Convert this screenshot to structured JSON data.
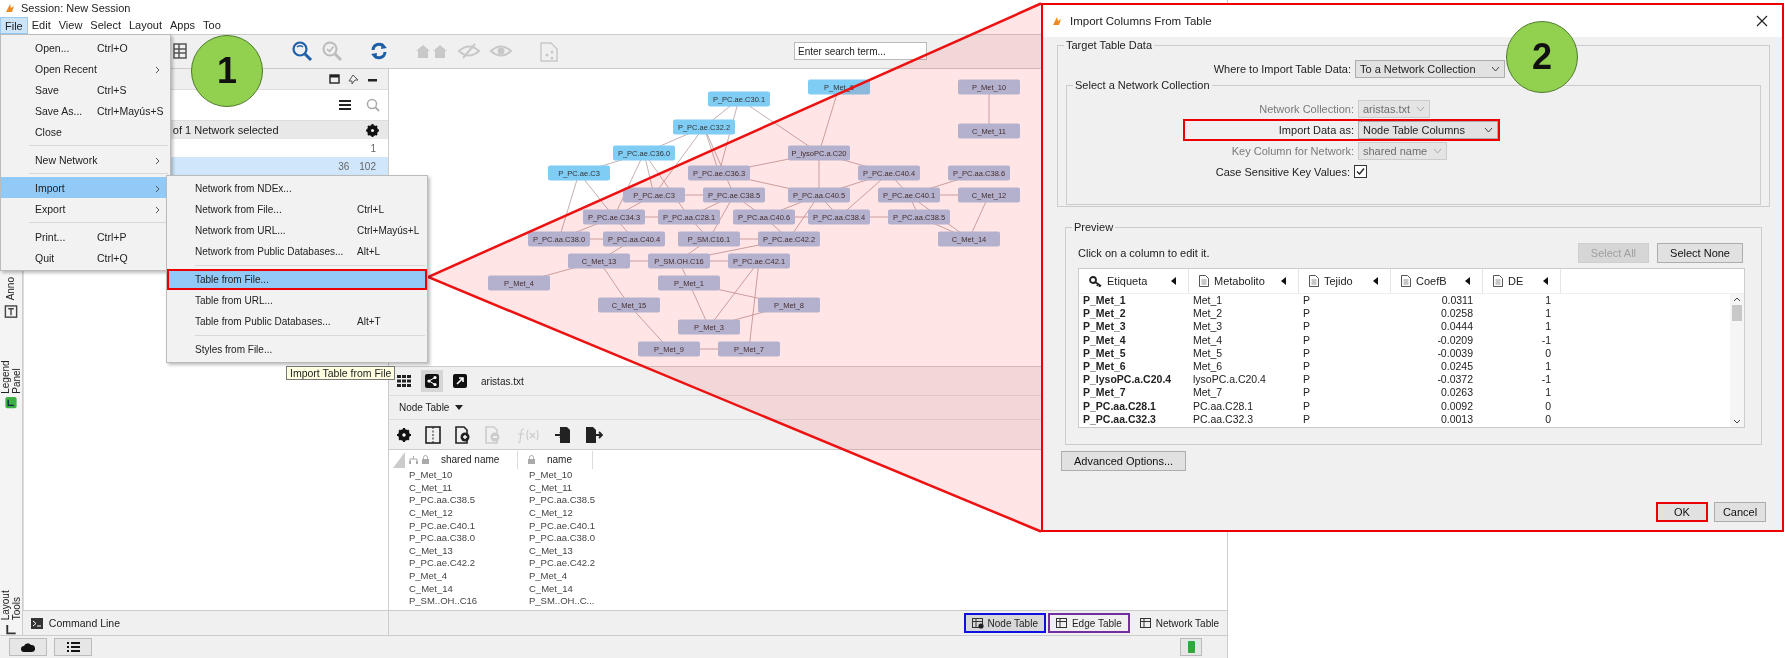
{
  "window": {
    "title": "Session: New Session"
  },
  "menubar": [
    {
      "label": "File",
      "selected": true
    },
    {
      "label": "Edit",
      "selected": false
    },
    {
      "label": "View",
      "selected": false
    },
    {
      "label": "Select",
      "selected": false
    },
    {
      "label": "Layout",
      "selected": false
    },
    {
      "label": "Apps",
      "selected": false
    },
    {
      "label": "Too",
      "selected": false
    }
  ],
  "file_menu": [
    {
      "kind": "item",
      "label": "Open...",
      "shortcut": "Ctrl+O",
      "has_submenu": false,
      "selected": false
    },
    {
      "kind": "item",
      "label": "Open Recent",
      "has_submenu": true,
      "selected": false
    },
    {
      "kind": "item",
      "label": "Save",
      "shortcut": "Ctrl+S",
      "has_submenu": false,
      "selected": false
    },
    {
      "kind": "item",
      "label": "Save As...",
      "shortcut": "Ctrl+Mayús+S",
      "has_submenu": false,
      "selected": false
    },
    {
      "kind": "item",
      "label": "Close",
      "has_submenu": false,
      "selected": false
    },
    {
      "kind": "separator"
    },
    {
      "kind": "item",
      "label": "New Network",
      "has_submenu": true,
      "selected": false
    },
    {
      "kind": "separator"
    },
    {
      "kind": "item",
      "label": "Import",
      "has_submenu": true,
      "selected": true
    },
    {
      "kind": "item",
      "label": "Export",
      "has_submenu": true,
      "selected": false
    },
    {
      "kind": "separator"
    },
    {
      "kind": "item",
      "label": "Print...",
      "shortcut": "Ctrl+P",
      "has_submenu": false,
      "selected": false
    },
    {
      "kind": "item",
      "label": "Quit",
      "shortcut": "Ctrl+Q",
      "has_submenu": false,
      "selected": false
    }
  ],
  "import_submenu": [
    {
      "kind": "item",
      "label": "Network from NDEx...",
      "selected": false,
      "highlighted": false
    },
    {
      "kind": "item",
      "label": "Network from File...",
      "shortcut": "Ctrl+L",
      "selected": false,
      "highlighted": false
    },
    {
      "kind": "item",
      "label": "Network from URL...",
      "shortcut": "Ctrl+Mayús+L",
      "selected": false,
      "highlighted": false
    },
    {
      "kind": "item",
      "label": "Network from Public Databases...",
      "shortcut": "Alt+L",
      "selected": false,
      "highlighted": false
    },
    {
      "kind": "separator"
    },
    {
      "kind": "item",
      "label": "Table from File...",
      "selected": true,
      "highlighted": true
    },
    {
      "kind": "item",
      "label": "Table from URL...",
      "selected": false,
      "highlighted": false
    },
    {
      "kind": "item",
      "label": "Table from Public Databases...",
      "shortcut": "Alt+T",
      "selected": false,
      "highlighted": false
    },
    {
      "kind": "separator"
    },
    {
      "kind": "item",
      "label": "Styles from File...",
      "selected": false,
      "highlighted": false
    }
  ],
  "tooltip": "Import Table from File",
  "step_badges": [
    "1",
    "2"
  ],
  "toolbar": {
    "search": {
      "placeholder": "Enter search term..."
    }
  },
  "side_tabs": [
    "Anno",
    "Legend Panel",
    "Layout Tools"
  ],
  "network_panel": {
    "summary": "of 1 Network selected",
    "rows": [
      {
        "values": [
          "1"
        ],
        "selected": false
      },
      {
        "values": [
          "36",
          "102"
        ],
        "selected": true
      }
    ]
  },
  "network": {
    "nodes": [
      {
        "label": "P_Met_6",
        "selected": true
      },
      {
        "label": "P_PC.ae.C30.1",
        "selected": true
      },
      {
        "label": "P_PC.ae.C32.2",
        "selected": true
      },
      {
        "label": "P_PC.ae.C36.0",
        "selected": true
      },
      {
        "label": "P_PC.ae.C3",
        "selected": true
      },
      {
        "label": "P_lysoPC.a.C20",
        "selected": false
      },
      {
        "label": "P_PC.ae.C3",
        "selected": false
      },
      {
        "label": "P_PC.ae.C36.3",
        "selected": false
      },
      {
        "label": "P_PC.ae.C34.3",
        "selected": false
      },
      {
        "label": "P_PC.ae.C38.5",
        "selected": false
      },
      {
        "label": "P_PC.ae.C40.4",
        "selected": false
      },
      {
        "label": "P_PC.aa.C38.6",
        "selected": false
      },
      {
        "label": "P_PC.aa.C40.5",
        "selected": false
      },
      {
        "label": "P_PC.ae.C40.1",
        "selected": false
      },
      {
        "label": "P_PC.aa.C38.0",
        "selected": false
      },
      {
        "label": "P_PC.aa.C28.1",
        "selected": false
      },
      {
        "label": "P_PC.aa.C40.6",
        "selected": false
      },
      {
        "label": "P_PC.aa.C38.4",
        "selected": false
      },
      {
        "label": "P_PC.aa.C38.5",
        "selected": false
      },
      {
        "label": "C_Met_12",
        "selected": false
      },
      {
        "label": "P_PC.aa.C40.4",
        "selected": false
      },
      {
        "label": "P_SM.C16.1",
        "selected": false
      },
      {
        "label": "P_PC.ae.C42.2",
        "selected": false
      },
      {
        "label": "C_Met_14",
        "selected": false
      },
      {
        "label": "C_Met_13",
        "selected": false
      },
      {
        "label": "P_SM.OH.C16",
        "selected": false
      },
      {
        "label": "P_Met_4",
        "selected": false
      },
      {
        "label": "P_Met_1",
        "selected": false
      },
      {
        "label": "P_PC.ae.C42.1",
        "selected": false
      },
      {
        "label": "C_Met_15",
        "selected": false
      },
      {
        "label": "P_Met_8",
        "selected": false
      },
      {
        "label": "P_Met_3",
        "selected": false
      },
      {
        "label": "P_Met_7",
        "selected": false
      },
      {
        "label": "P_Met_9",
        "selected": false
      },
      {
        "label": "P_Met_10",
        "selected": false
      },
      {
        "label": "C_Met_11",
        "selected": false
      }
    ]
  },
  "view_toolbar": {
    "network_name": "aristas.txt"
  },
  "table_panel": {
    "title": "Node Table",
    "columns": [
      "shared name",
      "name"
    ],
    "rows": [
      [
        "P_Met_10",
        "P_Met_10"
      ],
      [
        "C_Met_11",
        "C_Met_11"
      ],
      [
        "P_PC.aa.C38.5",
        "P_PC.aa.C38.5"
      ],
      [
        "C_Met_12",
        "C_Met_12"
      ],
      [
        "P_PC.ae.C40.1",
        "P_PC.ae.C40.1"
      ],
      [
        "P_PC.aa.C38.0",
        "P_PC.aa.C38.0"
      ],
      [
        "C_Met_13",
        "C_Met_13"
      ],
      [
        "P_PC.ae.C42.2",
        "P_PC.ae.C42.2"
      ],
      [
        "P_Met_4",
        "P_Met_4"
      ],
      [
        "C_Met_14",
        "C_Met_14"
      ],
      [
        "P_SM..OH..C16",
        "P_SM..OH..C..."
      ]
    ]
  },
  "table_tabs": [
    {
      "label": "Node Table",
      "selected": true,
      "color": "#1010e0"
    },
    {
      "label": "Edge Table",
      "selected": false,
      "color": "#7030a0"
    },
    {
      "label": "Network Table",
      "selected": false
    }
  ],
  "command_line": "Command Line",
  "dialog": {
    "title": "Import Columns From Table",
    "target": {
      "legend": "Target Table Data",
      "where_label": "Where to Import Table Data:",
      "where_value": "To a Network Collection",
      "collection_legend": "Select a Network Collection",
      "fields": [
        {
          "label": "Network Collection:",
          "value": "aristas.txt",
          "disabled": true,
          "highlighted": false
        },
        {
          "label": "Import Data as:",
          "value": "Node Table Columns",
          "disabled": false,
          "highlighted": true
        },
        {
          "label": "Key Column for Network:",
          "value": "shared name",
          "disabled": true,
          "highlighted": false
        }
      ],
      "case_sensitive": {
        "label": "Case Sensitive Key Values:",
        "checked": true
      }
    },
    "preview": {
      "legend": "Preview",
      "hint": "Click on a column to edit it.",
      "buttons": [
        {
          "label": "Select All",
          "disabled": true
        },
        {
          "label": "Select None",
          "disabled": false
        }
      ],
      "columns": [
        {
          "label": "Etiqueta",
          "kind": "key"
        },
        {
          "label": "Metabolito",
          "kind": "text"
        },
        {
          "label": "Tejido",
          "kind": "text"
        },
        {
          "label": "CoefB",
          "kind": "number"
        },
        {
          "label": "DE",
          "kind": "number"
        }
      ],
      "rows": [
        [
          "P_Met_1",
          "Met_1",
          "P",
          "0.0311",
          "1"
        ],
        [
          "P_Met_2",
          "Met_2",
          "P",
          "0.0258",
          "1"
        ],
        [
          "P_Met_3",
          "Met_3",
          "P",
          "0.0444",
          "1"
        ],
        [
          "P_Met_4",
          "Met_4",
          "P",
          "-0.0209",
          "-1"
        ],
        [
          "P_Met_5",
          "Met_5",
          "P",
          "-0.0039",
          "0"
        ],
        [
          "P_Met_6",
          "Met_6",
          "P",
          "0.0245",
          "1"
        ],
        [
          "P_lysoPC.a.C20.4",
          "lysoPC.a.C20.4",
          "P",
          "-0.0372",
          "-1"
        ],
        [
          "P_Met_7",
          "Met_7",
          "P",
          "0.0263",
          "1"
        ],
        [
          "P_PC.aa.C28.1",
          "PC.aa.C28.1",
          "P",
          "0.0092",
          "0"
        ],
        [
          "P_PC.aa.C32.3",
          "PC.aa.C32.3",
          "P",
          "0.0013",
          "0"
        ]
      ]
    },
    "advanced_button": "Advanced Options...",
    "buttons": [
      {
        "label": "OK",
        "highlighted": true
      },
      {
        "label": "Cancel",
        "highlighted": false
      }
    ]
  }
}
